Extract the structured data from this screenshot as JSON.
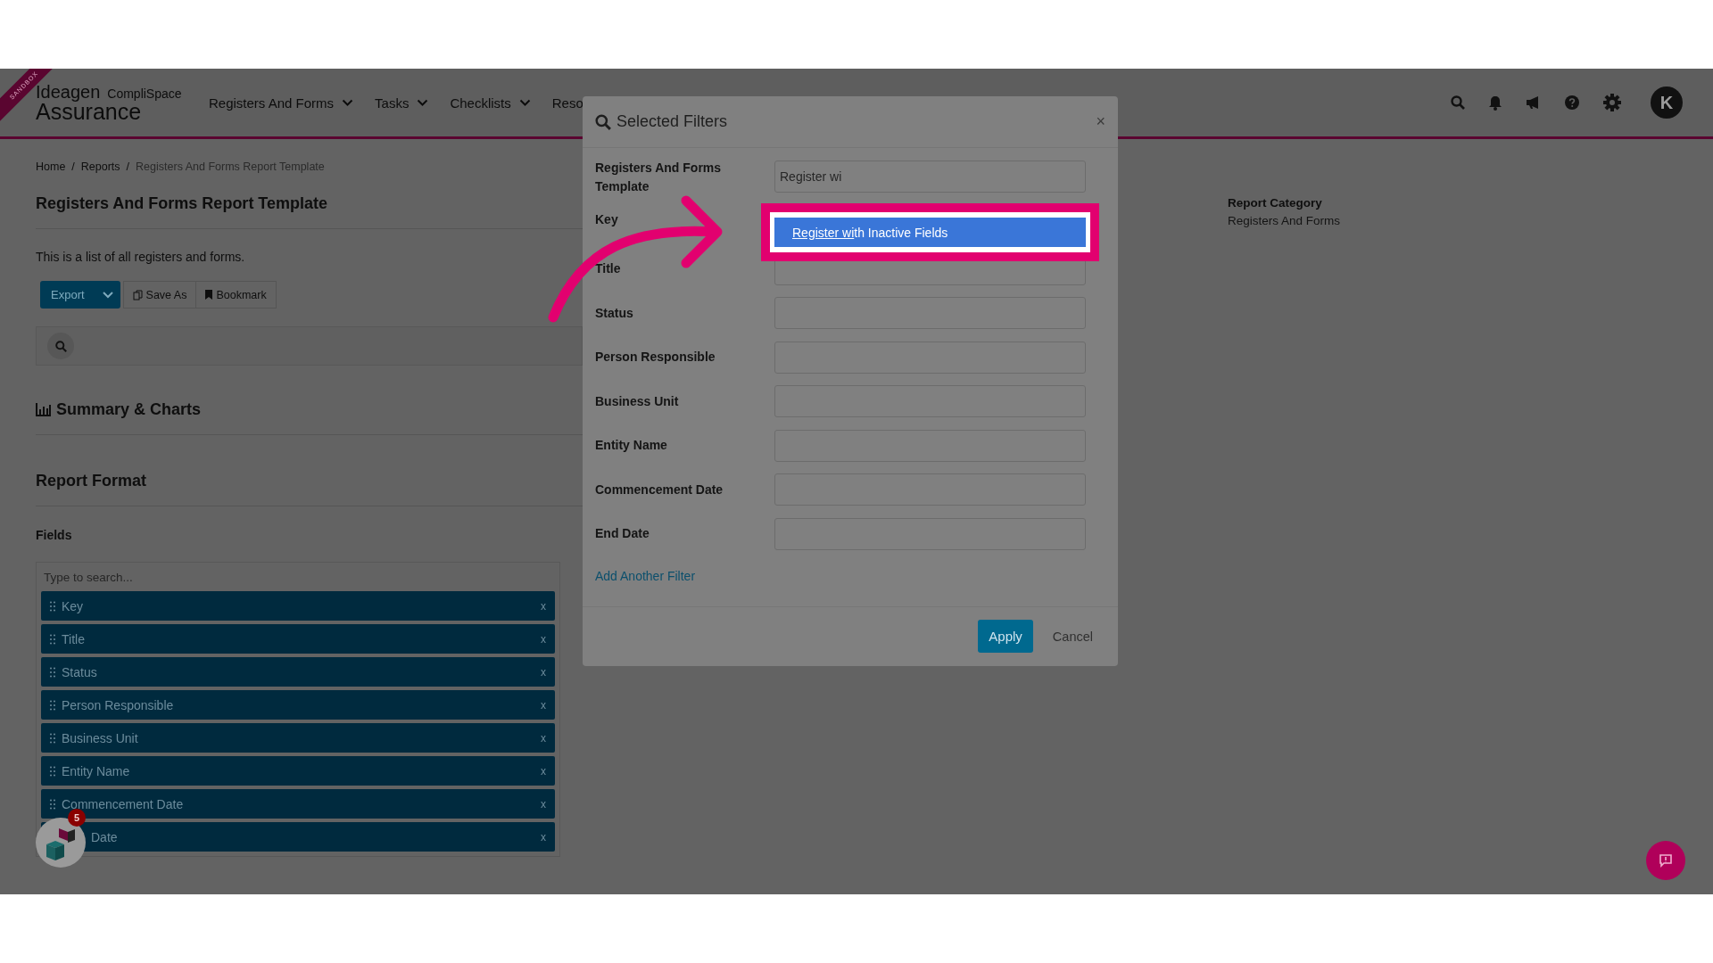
{
  "ribbon": "SANDBOX",
  "header": {
    "logo": {
      "brand": "Ideagen",
      "product": "CompliSpace",
      "sub": "Assurance"
    },
    "nav": [
      {
        "label": "Registers And Forms",
        "dropdown": true
      },
      {
        "label": "Tasks",
        "dropdown": true
      },
      {
        "label": "Checklists",
        "dropdown": true
      },
      {
        "label": "Reso",
        "dropdown": false
      }
    ],
    "avatar": "K"
  },
  "breadcrumb": {
    "separator": "/",
    "items": [
      "Home",
      "Reports",
      "Registers And Forms Report Template"
    ]
  },
  "page": {
    "title": "Registers And Forms Report Template",
    "description": "This is a list of all registers and forms.",
    "toolbar": {
      "export": "Export",
      "save_as": "Save As",
      "bookmark": "Bookmark"
    },
    "summary_heading": "Summary & Charts",
    "report_format_heading": "Report Format",
    "fields_label": "Fields",
    "fields_search": {
      "placeholder": "Type to search..."
    },
    "fields": [
      {
        "label": "Key",
        "remove": "x"
      },
      {
        "label": "Title",
        "remove": "x"
      },
      {
        "label": "Status",
        "remove": "x"
      },
      {
        "label": "Person Responsible",
        "remove": "x"
      },
      {
        "label": "Business Unit",
        "remove": "x"
      },
      {
        "label": "Entity Name",
        "remove": "x"
      },
      {
        "label": "Commencement Date",
        "remove": "x"
      },
      {
        "label": "Date",
        "remove": "x"
      }
    ]
  },
  "side": {
    "label": "Report Category",
    "value": "Registers And Forms"
  },
  "modal": {
    "title": "Selected Filters",
    "close": "×",
    "filters": [
      {
        "label": "Registers And Forms Template",
        "kind": "field",
        "value": "Register wi"
      },
      {
        "label": "Key",
        "kind": "covered"
      },
      {
        "label": "Title",
        "kind": "field"
      },
      {
        "label": "Status",
        "kind": "field"
      },
      {
        "label": "Person Responsible",
        "kind": "field"
      },
      {
        "label": "Business Unit",
        "kind": "field"
      },
      {
        "label": "Entity Name",
        "kind": "field"
      },
      {
        "label": "Commencement Date",
        "kind": "field"
      },
      {
        "label": "End Date",
        "kind": "field"
      }
    ],
    "suggestion": {
      "matched": "Register wi",
      "rest": "th Inactive Fields"
    },
    "add_filter": "Add Another Filter",
    "apply": "Apply",
    "cancel": "Cancel"
  },
  "help_widget": {
    "badge": "5"
  }
}
